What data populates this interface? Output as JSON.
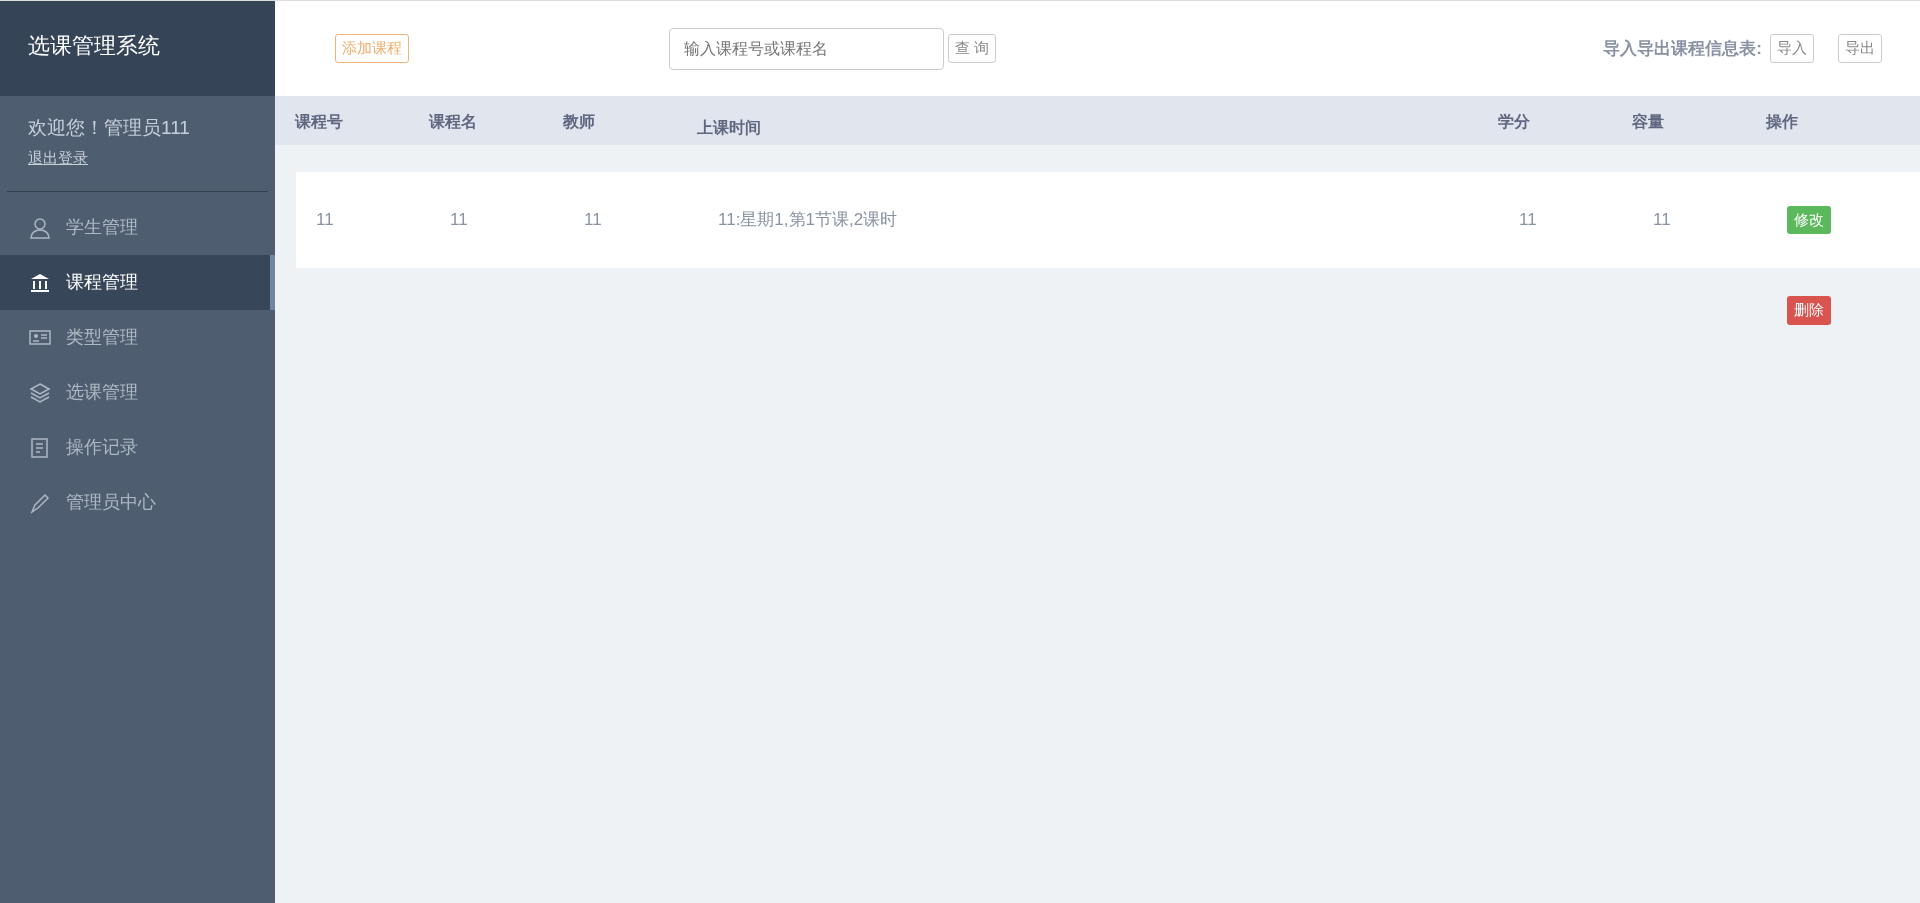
{
  "sidebar": {
    "title": "选课管理系统",
    "greeting": "欢迎您！管理员111",
    "logout": "退出登录",
    "items": [
      {
        "kind": "user",
        "label": "学生管理",
        "selected": false
      },
      {
        "kind": "bank",
        "label": "课程管理",
        "selected": true
      },
      {
        "kind": "card",
        "label": "类型管理",
        "selected": false
      },
      {
        "kind": "layers",
        "label": "选课管理",
        "selected": false
      },
      {
        "kind": "doc",
        "label": "操作记录",
        "selected": false
      },
      {
        "kind": "pen",
        "label": "管理员中心",
        "selected": false
      }
    ]
  },
  "toolbar": {
    "add_button": "添加课程",
    "search": {
      "placeholder": "输入课程号或课程名"
    },
    "search_button": "查 询",
    "io_label": "导入导出课程信息表:",
    "import_button": "导入",
    "export_button": "导出"
  },
  "table": {
    "columns": [
      "课程号",
      "课程名",
      "教师",
      "上课时间",
      "学分",
      "容量",
      "操作"
    ],
    "rows": [
      {
        "cells": [
          "11",
          "11",
          "11",
          "11:星期1,第1节课,2课时",
          "11",
          "11"
        ],
        "actions": [
          {
            "kind": "edit",
            "label": "修改"
          },
          {
            "kind": "delete",
            "label": "删除"
          }
        ]
      }
    ]
  }
}
